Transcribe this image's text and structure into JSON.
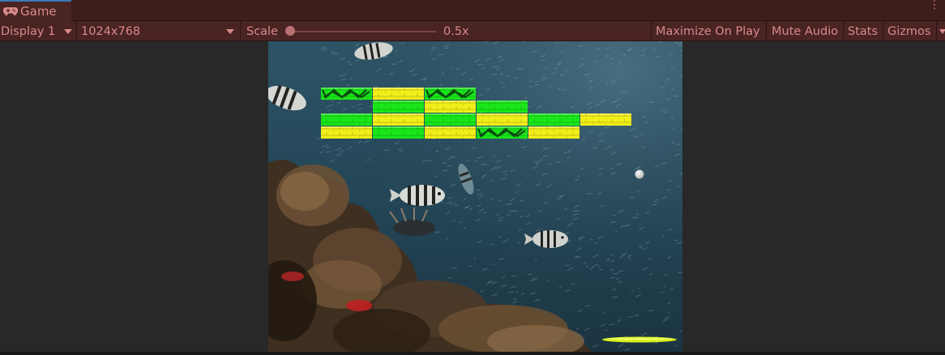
{
  "window": {
    "tab_label": "Game",
    "tab_icon": "gamepad-icon"
  },
  "toolbar": {
    "display_label": "Display 1",
    "resolution_label": "1024x768",
    "scale_label": "Scale",
    "scale_value_label": "0.5x",
    "scale_value": 0.5,
    "maximize_label": "Maximize On Play",
    "mute_label": "Mute Audio",
    "stats_label": "Stats",
    "gizmos_label": "Gizmos"
  },
  "game": {
    "background": "underwater-reef-with-fish",
    "bricks": [
      {
        "row": 0,
        "col": 0,
        "color": "green",
        "cracked": true
      },
      {
        "row": 0,
        "col": 1,
        "color": "yellow",
        "cracked": false
      },
      {
        "row": 0,
        "col": 2,
        "color": "green",
        "cracked": true
      },
      {
        "row": 1,
        "col": 1,
        "color": "green",
        "cracked": false
      },
      {
        "row": 1,
        "col": 2,
        "color": "yellow",
        "cracked": false
      },
      {
        "row": 1,
        "col": 3,
        "color": "green",
        "cracked": false
      },
      {
        "row": 2,
        "col": 0,
        "color": "green",
        "cracked": false
      },
      {
        "row": 2,
        "col": 1,
        "color": "yellow",
        "cracked": false
      },
      {
        "row": 2,
        "col": 2,
        "color": "green",
        "cracked": false
      },
      {
        "row": 2,
        "col": 3,
        "color": "yellow",
        "cracked": false
      },
      {
        "row": 2,
        "col": 4,
        "color": "green",
        "cracked": false
      },
      {
        "row": 2,
        "col": 5,
        "color": "yellow",
        "cracked": false
      },
      {
        "row": 3,
        "col": 0,
        "color": "yellow",
        "cracked": false
      },
      {
        "row": 3,
        "col": 1,
        "color": "green",
        "cracked": false
      },
      {
        "row": 3,
        "col": 2,
        "color": "yellow",
        "cracked": false
      },
      {
        "row": 3,
        "col": 3,
        "color": "green",
        "cracked": true
      },
      {
        "row": 3,
        "col": 4,
        "color": "yellow",
        "cracked": false
      }
    ],
    "colors": {
      "green": "#19e619",
      "yellow": "#f2ee19",
      "paddle": "#d8f01a",
      "ball": "#f0f0f0"
    }
  }
}
